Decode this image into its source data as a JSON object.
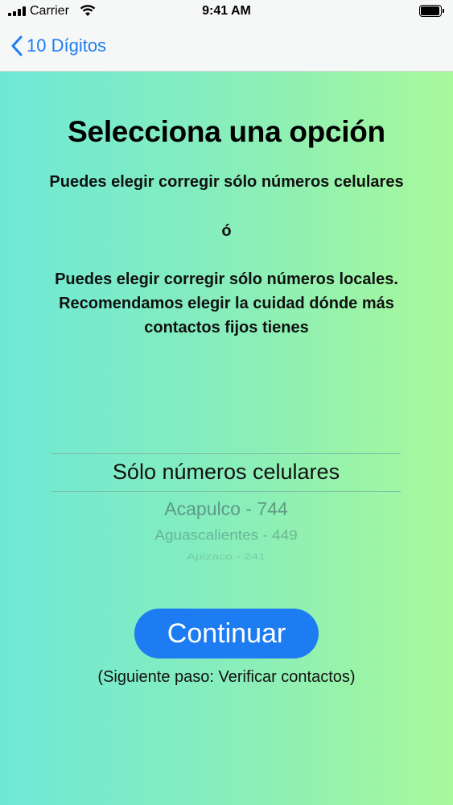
{
  "status_bar": {
    "carrier": "Carrier",
    "time": "9:41 AM"
  },
  "nav": {
    "back_label": "10 Dígitos",
    "accent_color": "#1e7cf2"
  },
  "content": {
    "title": "Selecciona una opción",
    "option1_text": "Puedes elegir corregir sólo números celulares",
    "separator": "ó",
    "option2_lines": [
      "Puedes elegir corregir sólo números locales.",
      "Recomendamos elegir la cuidad dónde más",
      "contactos fijos tienes"
    ]
  },
  "picker": {
    "selected": "Sólo números celulares",
    "options": [
      "Acapulco - 744",
      "Aguascalientes - 449",
      "Apizaco - 241"
    ]
  },
  "continue_button": {
    "label": "Continuar"
  },
  "next_step_note": "(Siguiente paso: Verificar contactos)"
}
